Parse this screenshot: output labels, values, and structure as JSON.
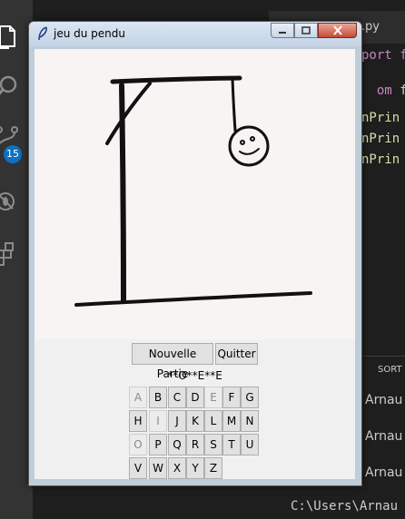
{
  "vscode": {
    "badge": "15",
    "tab": "pale.py",
    "code": [
      {
        "a": "port f",
        "b": ""
      },
      {
        "a": "om",
        "b": " fe"
      },
      {
        "a": "nPrin",
        "b": ""
      },
      {
        "a": "nPrin",
        "b": ""
      },
      {
        "a": "nPrin",
        "b": ""
      }
    ],
    "panel_title": "SORT",
    "output": [
      "Arnau",
      "Arnau",
      "Arnau"
    ],
    "terminal": "C:\\Users\\Arnau"
  },
  "window": {
    "title": "jeu du pendu",
    "new_game": "Nouvelle Partie",
    "quit": "Quitter",
    "word": "**O**E**E",
    "letters": [
      {
        "l": "A",
        "used": true
      },
      {
        "l": "B",
        "used": false
      },
      {
        "l": "C",
        "used": false
      },
      {
        "l": "D",
        "used": false
      },
      {
        "l": "E",
        "used": true
      },
      {
        "l": "F",
        "used": false
      },
      {
        "l": "G",
        "used": false
      },
      {
        "l": "H",
        "used": false
      },
      {
        "l": "I",
        "used": true
      },
      {
        "l": "J",
        "used": false
      },
      {
        "l": "K",
        "used": false
      },
      {
        "l": "L",
        "used": false
      },
      {
        "l": "M",
        "used": false
      },
      {
        "l": "N",
        "used": false
      },
      {
        "l": "O",
        "used": true
      },
      {
        "l": "P",
        "used": false
      },
      {
        "l": "Q",
        "used": false
      },
      {
        "l": "R",
        "used": false
      },
      {
        "l": "S",
        "used": false
      },
      {
        "l": "T",
        "used": false
      },
      {
        "l": "U",
        "used": false
      },
      {
        "l": "V",
        "used": false
      },
      {
        "l": "W",
        "used": false
      },
      {
        "l": "X",
        "used": false
      },
      {
        "l": "Y",
        "used": false
      },
      {
        "l": "Z",
        "used": false
      }
    ]
  },
  "colors": {
    "keyword": "#c586c0",
    "text": "#cccccc",
    "default_fn": "#dcdcaa",
    "badge": "#0e70c0"
  }
}
